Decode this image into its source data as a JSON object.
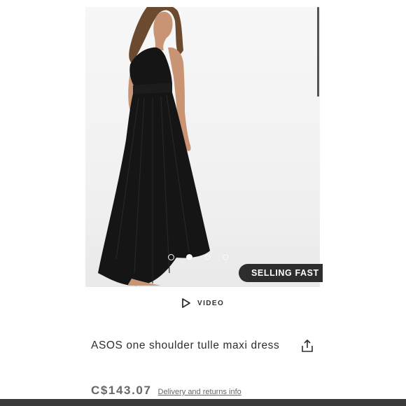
{
  "product": {
    "title": "ASOS one shoulder tulle maxi dress",
    "price": "C$143.07",
    "delivery_link": "Delivery and returns info"
  },
  "gallery": {
    "badge": "SELLING FAST",
    "video_label": "VIDEO",
    "slide_count": 4,
    "active_slide": 2,
    "icons": {
      "play": "play-icon",
      "share": "share-icon"
    }
  },
  "colors": {
    "text_dark": "#2d2d2d",
    "price_gray": "#666666",
    "badge_bg": "#2d2d2d",
    "dress": "#151515"
  }
}
